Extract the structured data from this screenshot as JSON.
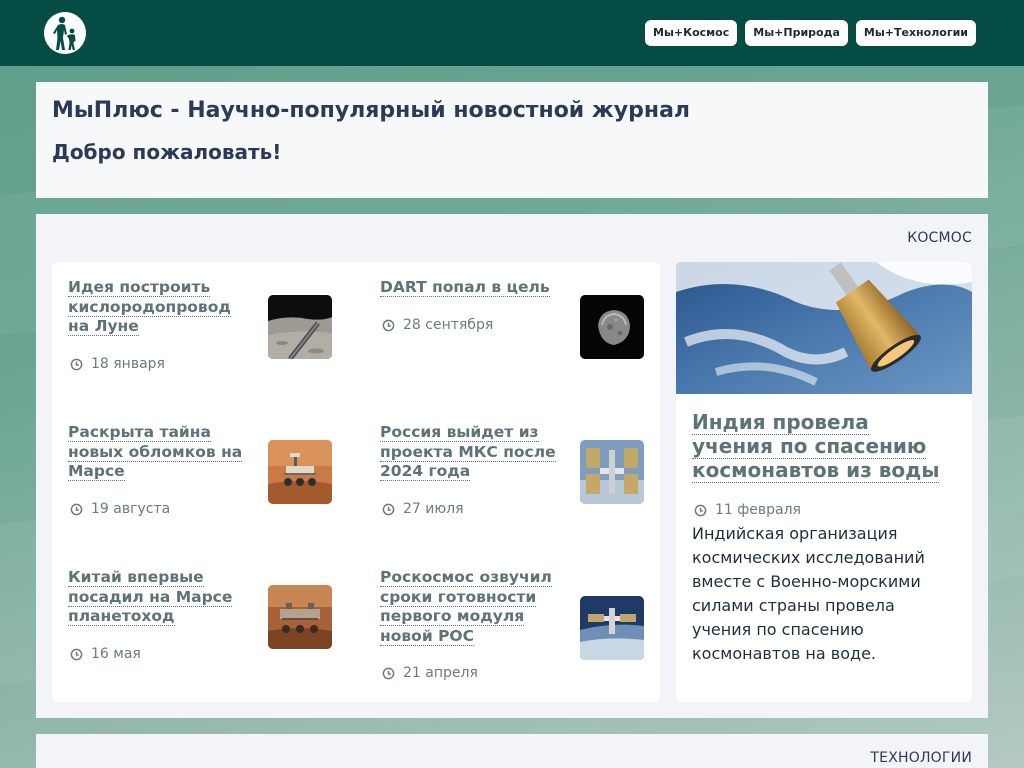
{
  "header": {
    "logo_icon": "parent-child-logo-icon",
    "nav": [
      "Мы+Космос",
      "Мы+Природа",
      "Мы+Технологии"
    ]
  },
  "intro": {
    "title": "МыПлюс - Научно-популярный новостной журнал",
    "welcome": "Добро пожаловать!"
  },
  "space_section": {
    "label": "КОСМОС",
    "articles": [
      {
        "title": "Идея построить кислородопровод на Луне",
        "date": "18 января",
        "image": "moon-pipeline-thumbnail"
      },
      {
        "title": "DART попал в цель",
        "date": "28 сентября",
        "image": "asteroid-thumbnail"
      },
      {
        "title": "Раскрыта тайна новых обломков на Марсе",
        "date": "19 августа",
        "image": "mars-rover-thumbnail"
      },
      {
        "title": "Россия выйдет из проекта МКС после 2024 года",
        "date": "27 июля",
        "image": "iss-thumbnail"
      },
      {
        "title": "Китай впервые посадил на Марсе планетоход",
        "date": "16 мая",
        "image": "zhurong-rover-thumbnail"
      },
      {
        "title": "Роскосмос озвучил сроки готовности первого модуля новой РОС",
        "date": "21 апреля",
        "image": "space-station-thumbnail"
      }
    ],
    "feature": {
      "title": "Индия провела учения по спасению космонавтов из воды",
      "date": "11 февраля",
      "description": "Индийская организация космических исследований вместе с Военно-морскими силами страны провела учения по спасению космонавтов на воде.",
      "image": "spacecraft-over-earth-image"
    }
  },
  "tech_section": {
    "label": "ТЕХНОЛОГИИ"
  },
  "colors": {
    "header_bg": "#054d44",
    "title_text": "#2b3b57",
    "link_text": "#5d7377"
  }
}
